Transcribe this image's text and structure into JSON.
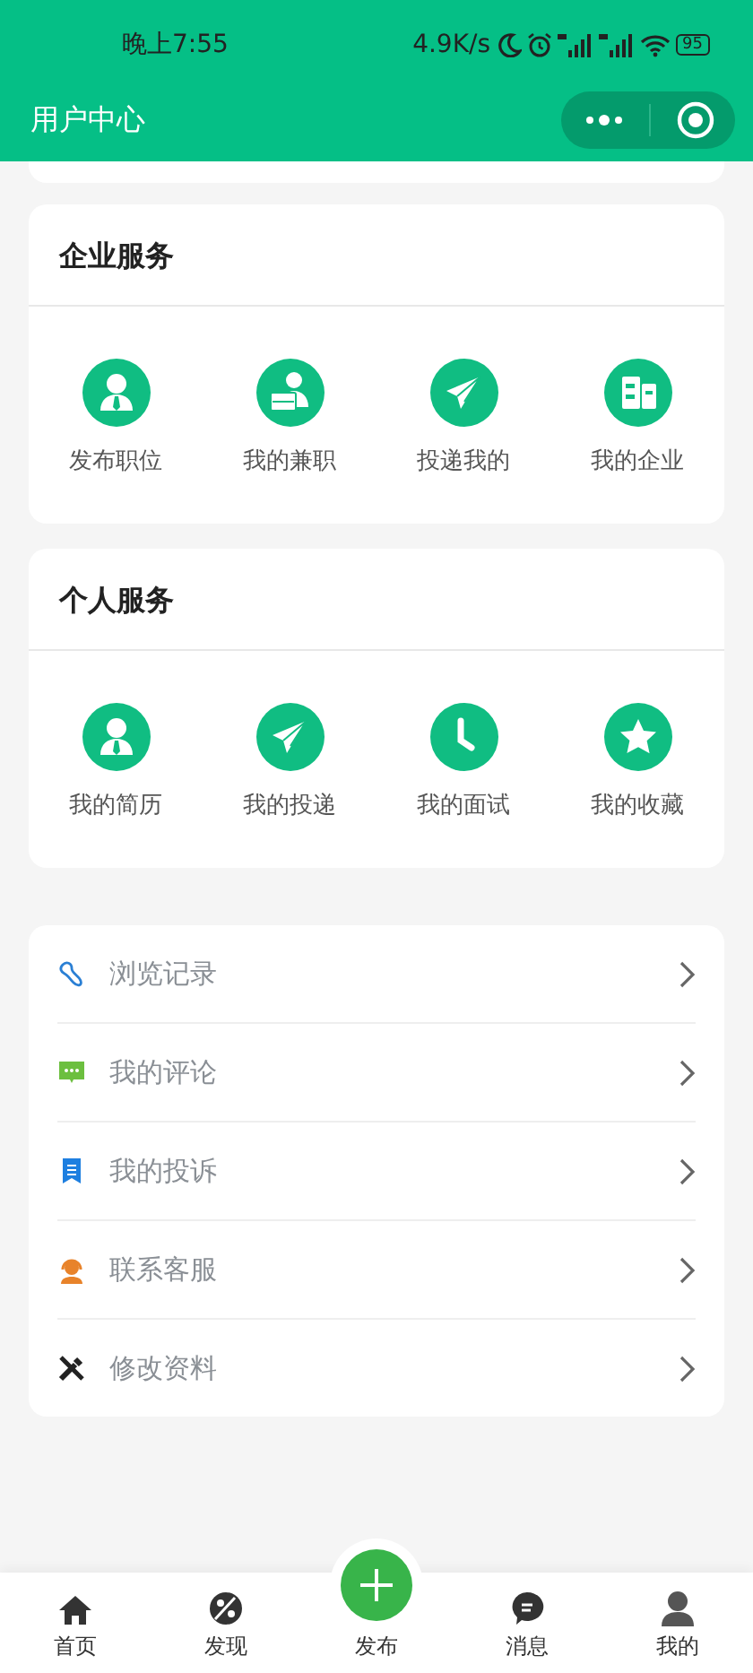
{
  "status_bar": {
    "time": "晚上7:55",
    "speed": "4.9K/s",
    "battery": "95"
  },
  "header": {
    "title": "用户中心"
  },
  "sections": [
    {
      "title": "企业服务",
      "items": [
        {
          "label": "发布职位",
          "kind": "person-tie"
        },
        {
          "label": "我的兼职",
          "kind": "person-case"
        },
        {
          "label": "投递我的",
          "kind": "send"
        },
        {
          "label": "我的企业",
          "kind": "building"
        }
      ]
    },
    {
      "title": "个人服务",
      "items": [
        {
          "label": "我的简历",
          "kind": "person-tie"
        },
        {
          "label": "我的投递",
          "kind": "send"
        },
        {
          "label": "我的面试",
          "kind": "clock"
        },
        {
          "label": "我的收藏",
          "kind": "star"
        }
      ]
    }
  ],
  "menu": [
    {
      "label": "浏览记录",
      "kind": "footprint"
    },
    {
      "label": "我的评论",
      "kind": "comment"
    },
    {
      "label": "我的投诉",
      "kind": "bookmark"
    },
    {
      "label": "联系客服",
      "kind": "agent"
    },
    {
      "label": "修改资料",
      "kind": "tools"
    }
  ],
  "tab_bar": [
    {
      "label": "首页",
      "kind": "home"
    },
    {
      "label": "发现",
      "kind": "discover"
    },
    {
      "label": "发布",
      "kind": "add"
    },
    {
      "label": "消息",
      "kind": "message"
    },
    {
      "label": "我的",
      "kind": "user"
    }
  ]
}
